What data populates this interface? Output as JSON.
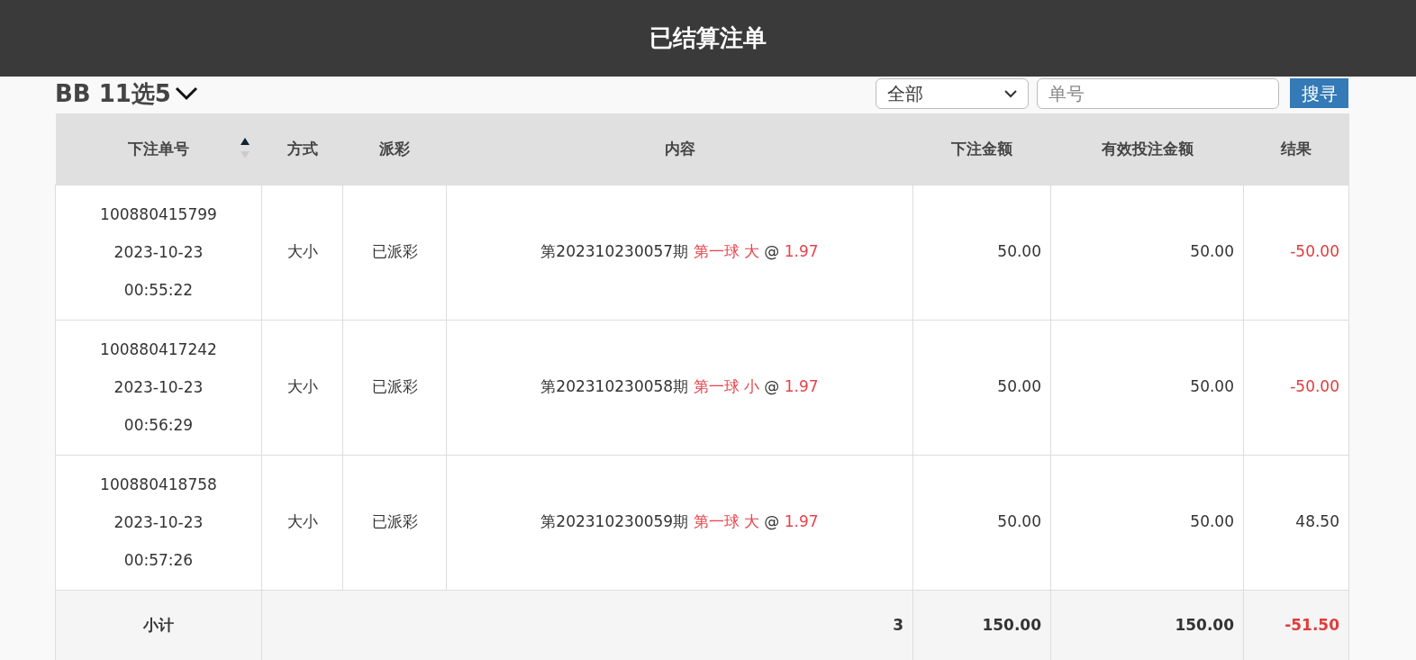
{
  "header": {
    "title": "已结算注单"
  },
  "game_title": "BB 11选5",
  "filter": {
    "value": "全部"
  },
  "search": {
    "placeholder": "单号",
    "button": "搜寻"
  },
  "table": {
    "columns": [
      {
        "label": "下注单号",
        "sortable": true
      },
      {
        "label": "方式",
        "sortable": false
      },
      {
        "label": "派彩",
        "sortable": false
      },
      {
        "label": "内容",
        "sortable": false
      },
      {
        "label": "下注金额",
        "sortable": false
      },
      {
        "label": "有效投注金额",
        "sortable": false
      },
      {
        "label": "结果",
        "sortable": false
      }
    ],
    "rows": [
      {
        "bet_id": "100880415799",
        "date": "2023-10-23",
        "time": "00:55:22",
        "method": "大小",
        "payout": "已派彩",
        "period": "第202310230057期",
        "pick": "第一球 大",
        "at": "@",
        "odds": "1.97",
        "amount": "50.00",
        "valid_amount": "50.00",
        "result": "-50.00",
        "loss": true
      },
      {
        "bet_id": "100880417242",
        "date": "2023-10-23",
        "time": "00:56:29",
        "method": "大小",
        "payout": "已派彩",
        "period": "第202310230058期",
        "pick": "第一球 小",
        "at": "@",
        "odds": "1.97",
        "amount": "50.00",
        "valid_amount": "50.00",
        "result": "-50.00",
        "loss": true
      },
      {
        "bet_id": "100880418758",
        "date": "2023-10-23",
        "time": "00:57:26",
        "method": "大小",
        "payout": "已派彩",
        "period": "第202310230059期",
        "pick": "第一球 大",
        "at": "@",
        "odds": "1.97",
        "amount": "50.00",
        "valid_amount": "50.00",
        "result": "48.50",
        "loss": false
      }
    ],
    "subtotal": {
      "label": "小计",
      "count": "3",
      "amount": "150.00",
      "valid_amount": "150.00",
      "result": "-51.50",
      "loss": true
    }
  }
}
